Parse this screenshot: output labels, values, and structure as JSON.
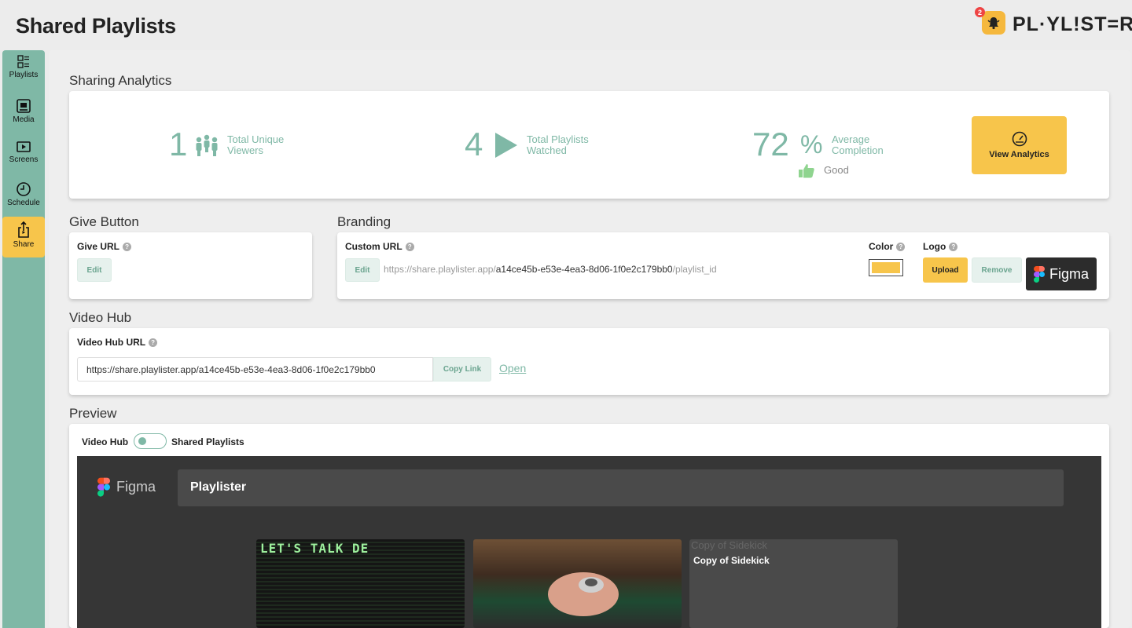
{
  "header": {
    "title": "Shared Playlists",
    "notification_count": "2",
    "brand": "PL·YL!ST=R"
  },
  "sidebar": {
    "items": [
      {
        "label": "Playlists",
        "icon": "playlists-icon"
      },
      {
        "label": "Media",
        "icon": "media-icon"
      },
      {
        "label": "Screens",
        "icon": "screens-icon"
      },
      {
        "label": "Schedule",
        "icon": "schedule-icon"
      },
      {
        "label": "Share",
        "icon": "share-icon",
        "active": true
      }
    ]
  },
  "analytics": {
    "section_title": "Sharing Analytics",
    "unique_viewers": {
      "value": "1",
      "label_line1": "Total Unique",
      "label_line2": "Viewers"
    },
    "playlists_watched": {
      "value": "4",
      "label_line1": "Total Playlists",
      "label_line2": "Watched"
    },
    "completion": {
      "value": "72",
      "unit": "%",
      "label_line1": "Average",
      "label_line2": "Completion",
      "rating": "Good"
    },
    "view_button": "View Analytics"
  },
  "give_button": {
    "section_title": "Give Button",
    "field_label": "Give URL",
    "edit_label": "Edit"
  },
  "branding": {
    "section_title": "Branding",
    "custom_url_label": "Custom URL",
    "edit_label": "Edit",
    "url_prefix": "https://share.playlister.app/",
    "url_id": "a14ce45b-e53e-4ea3-8d06-1f0e2c179bb0",
    "url_suffix": "/playlist_id",
    "color_label": "Color",
    "color_value": "#f7c54b",
    "logo_label": "Logo",
    "upload_label": "Upload",
    "remove_label": "Remove",
    "logo_text": "Figma"
  },
  "video_hub": {
    "section_title": "Video Hub",
    "url_label": "Video Hub URL",
    "url": "https://share.playlister.app/a14ce45b-e53e-4ea3-8d06-1f0e2c179bb0",
    "copy_label": "Copy Link",
    "open_label": "Open"
  },
  "preview": {
    "section_title": "Preview",
    "toggle_left": "Video Hub",
    "toggle_right": "Shared Playlists",
    "logo_text": "Figma",
    "bar_title": "Playlister",
    "thumb1_text": "LET'S TALK DE",
    "thumb3_alt": "Copy of Sidekick",
    "thumb3_title": "Copy of Sidekick"
  },
  "colors": {
    "accent": "#7fb8a6",
    "yellow": "#f7c54b"
  }
}
